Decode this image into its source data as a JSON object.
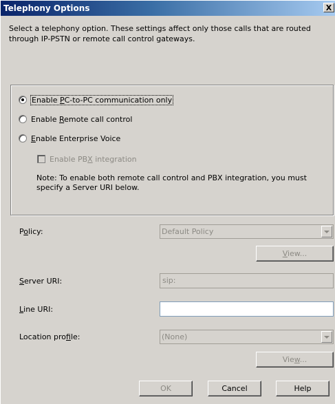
{
  "window": {
    "title": "Telephony Options",
    "close_glyph": "X"
  },
  "intro": "Select a telephony option. These settings affect only those calls that are routed through IP-PSTN or remote call control gateways.",
  "options": {
    "pc_to_pc": {
      "pre": "Enable ",
      "key": "P",
      "post": "C-to-PC communication only",
      "checked": true
    },
    "remote": {
      "pre": "Enable ",
      "key": "R",
      "post": "emote call control",
      "checked": false
    },
    "enterprise": {
      "pre": "",
      "key": "E",
      "post": "nable Enterprise Voice",
      "checked": false
    },
    "pbx": {
      "pre": "Enable PB",
      "key": "X",
      "post": " integration",
      "checked": false,
      "enabled": false
    }
  },
  "note": "Note: To enable both remote call control and PBX integration, you must specify a Server URI below.",
  "policy": {
    "label_pre": "P",
    "label_key": "o",
    "label_post": "licy:",
    "value": "Default Policy",
    "view_pre": "",
    "view_key": "V",
    "view_post": "iew..."
  },
  "server_uri": {
    "label_pre": "",
    "label_key": "S",
    "label_post": "erver URI:",
    "value": "sip:"
  },
  "line_uri": {
    "label_pre": "",
    "label_key": "L",
    "label_post": "ine URI:",
    "value": ""
  },
  "location": {
    "label_pre": "Location pro",
    "label_key": "f",
    "label_post": "ile:",
    "value": "(None)",
    "view_pre": "Vie",
    "view_key": "w",
    "view_post": "..."
  },
  "buttons": {
    "ok": "OK",
    "cancel": "Cancel",
    "help": "Help"
  },
  "colors": {
    "title_start": "#0a246a",
    "title_end": "#a6caf0",
    "dialog_bg": "#d6d3ce",
    "disabled_text": "#8c8a84"
  }
}
